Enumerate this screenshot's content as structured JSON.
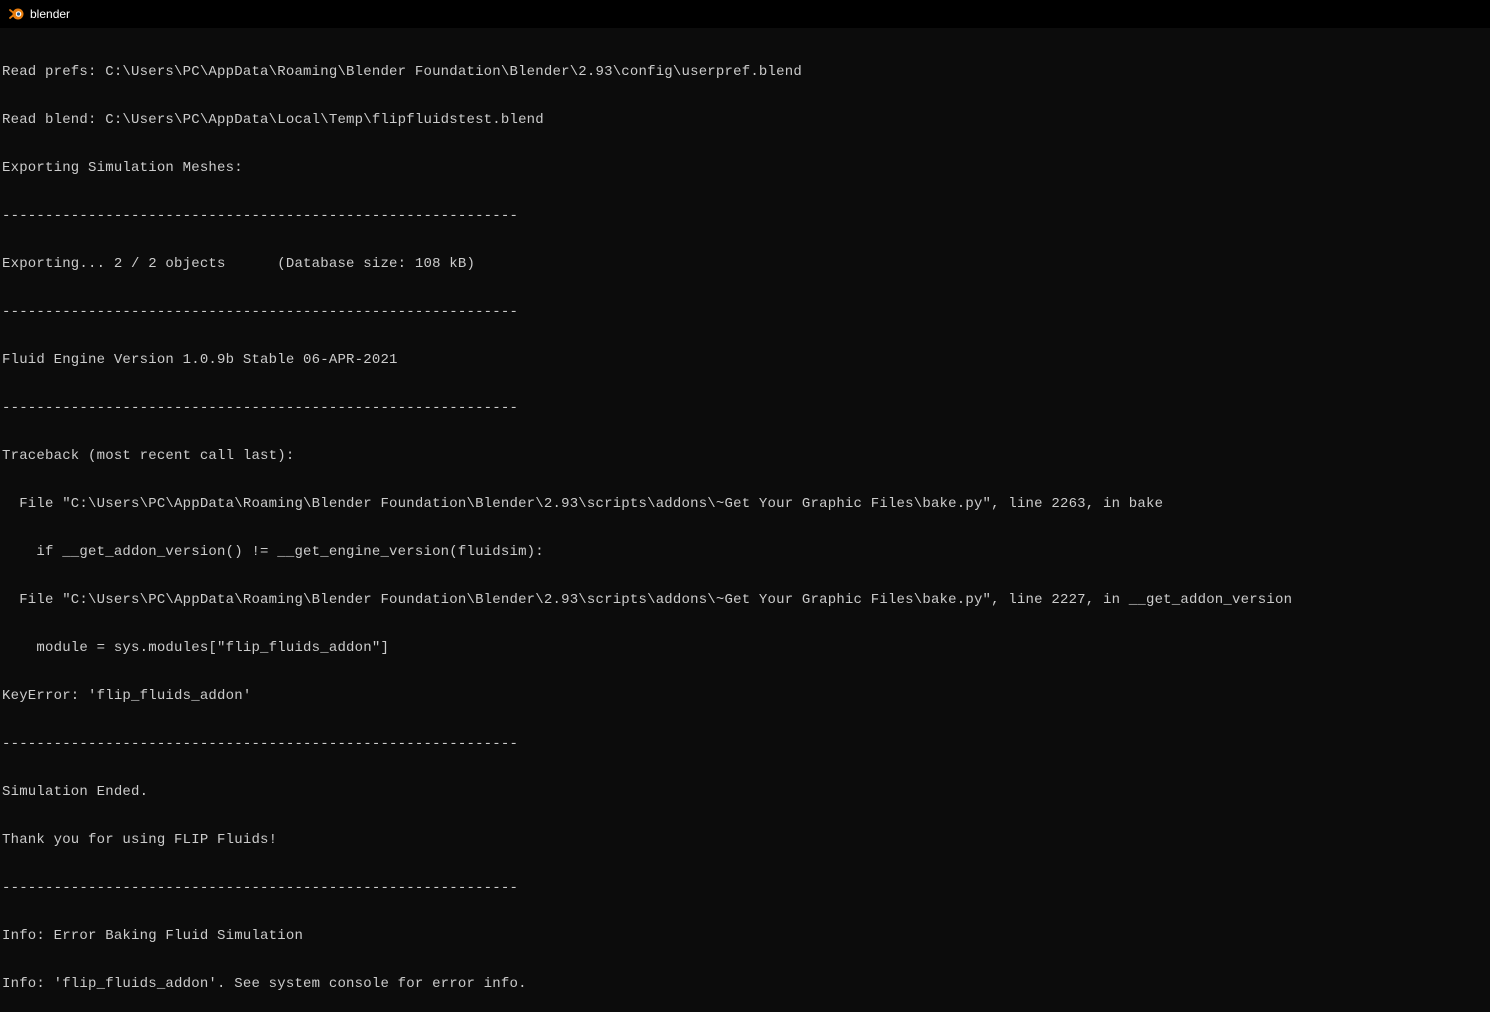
{
  "titlebar": {
    "icon_name": "blender-icon",
    "title": "blender"
  },
  "console": {
    "lines": [
      "Read prefs: C:\\Users\\PC\\AppData\\Roaming\\Blender Foundation\\Blender\\2.93\\config\\userpref.blend",
      "Read blend: C:\\Users\\PC\\AppData\\Local\\Temp\\flipfluidstest.blend",
      "Exporting Simulation Meshes:",
      "------------------------------------------------------------",
      "Exporting... 2 / 2 objects      (Database size: 108 kB)",
      "------------------------------------------------------------",
      "Fluid Engine Version 1.0.9b Stable 06-APR-2021",
      "------------------------------------------------------------",
      "Traceback (most recent call last):",
      "  File \"C:\\Users\\PC\\AppData\\Roaming\\Blender Foundation\\Blender\\2.93\\scripts\\addons\\~Get Your Graphic Files\\bake.py\", line 2263, in bake",
      "    if __get_addon_version() != __get_engine_version(fluidsim):",
      "  File \"C:\\Users\\PC\\AppData\\Roaming\\Blender Foundation\\Blender\\2.93\\scripts\\addons\\~Get Your Graphic Files\\bake.py\", line 2227, in __get_addon_version",
      "    module = sys.modules[\"flip_fluids_addon\"]",
      "KeyError: 'flip_fluids_addon'",
      "------------------------------------------------------------",
      "Simulation Ended.",
      "Thank you for using FLIP Fluids!",
      "------------------------------------------------------------",
      "Info: Error Baking Fluid Simulation",
      "Info: 'flip_fluids_addon'. See system console for error info."
    ]
  }
}
